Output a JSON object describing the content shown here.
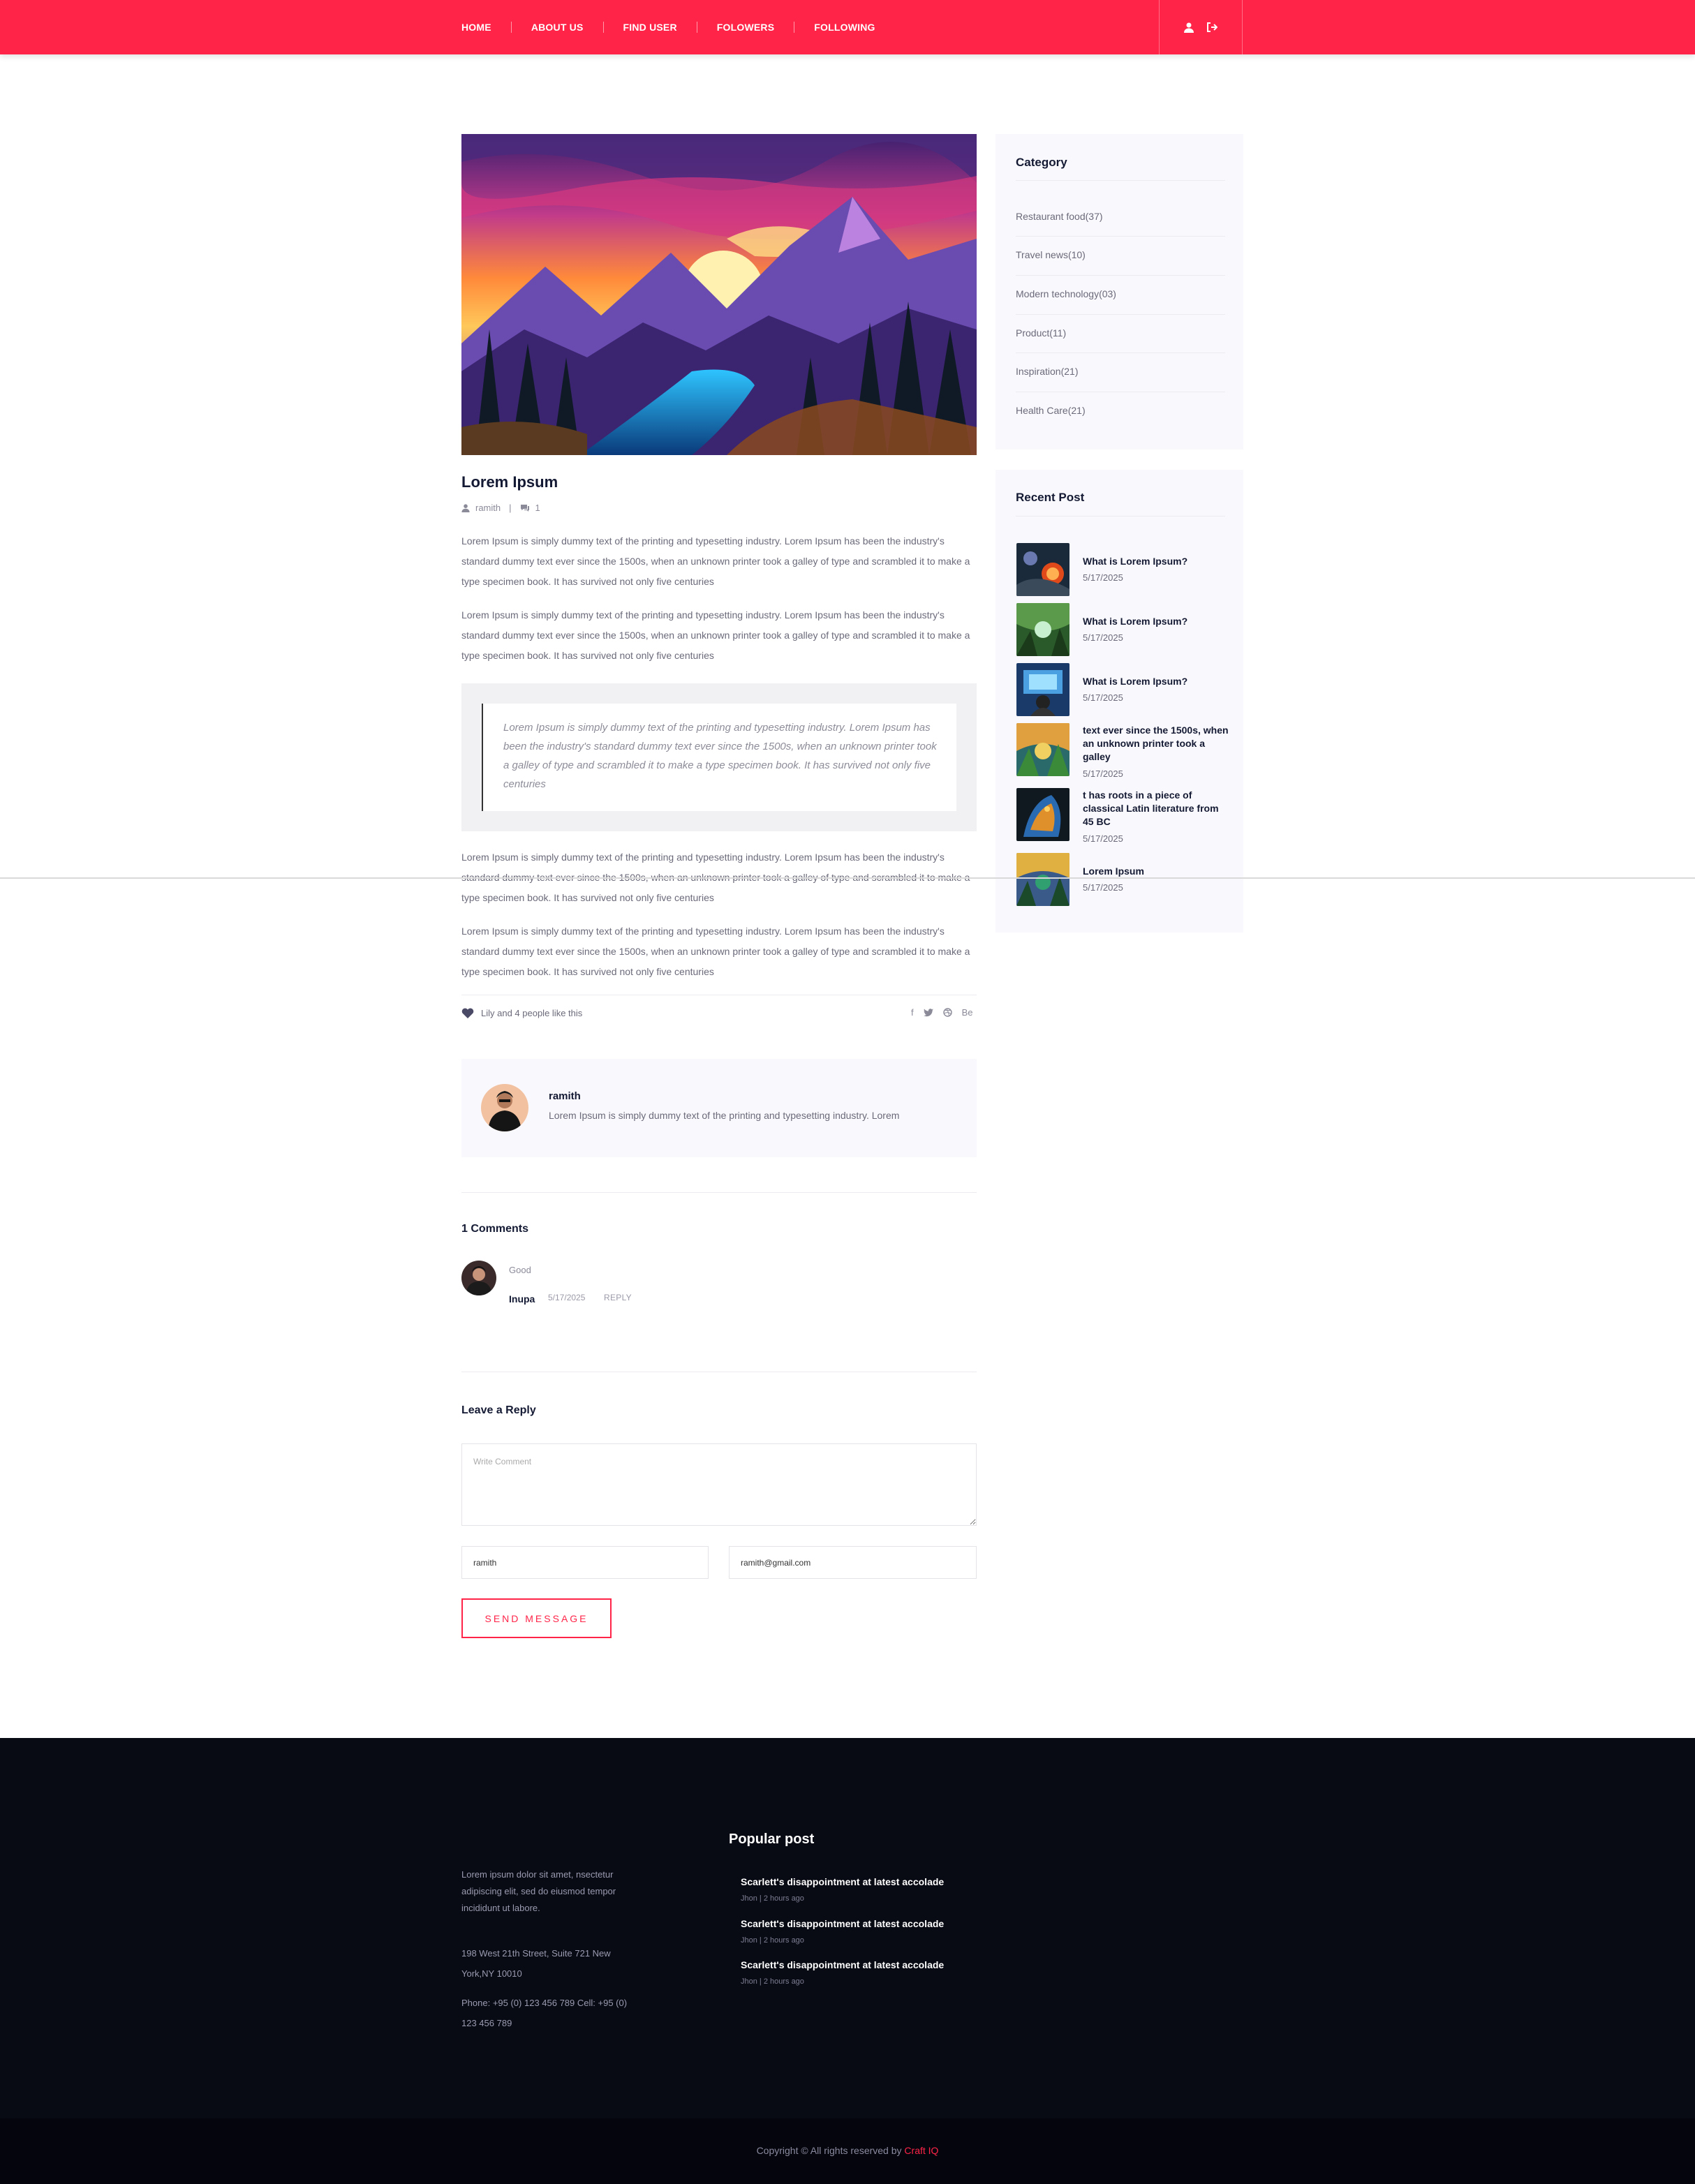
{
  "nav": {
    "items": [
      "HOME",
      "ABOUT US",
      "FIND USER",
      "FOLOWERS",
      "FOLLOWING"
    ],
    "user_icon": "user-icon",
    "logout_icon": "sign-out-icon"
  },
  "post": {
    "title": "Lorem Ipsum",
    "author": "ramith",
    "comment_count": "1",
    "paragraphs": [
      "Lorem Ipsum is simply dummy text of the printing and typesetting industry. Lorem Ipsum has been the industry's standard dummy text ever since the 1500s, when an unknown printer took a galley of type and scrambled it to make a type specimen book. It has survived not only five centuries",
      "Lorem Ipsum is simply dummy text of the printing and typesetting industry. Lorem Ipsum has been the industry's standard dummy text ever since the 1500s, when an unknown printer took a galley of type and scrambled it to make a type specimen book. It has survived not only five centuries",
      "Lorem Ipsum is simply dummy text of the printing and typesetting industry. Lorem Ipsum has been the industry's standard dummy text ever since the 1500s, when an unknown printer took a galley of type and scrambled it to make a type specimen book. It has survived not only five centuries",
      "Lorem Ipsum is simply dummy text of the printing and typesetting industry. Lorem Ipsum has been the industry's standard dummy text ever since the 1500s, when an unknown printer took a galley of type and scrambled it to make a type specimen book. It has survived not only five centuries"
    ],
    "quote": "Lorem Ipsum is simply dummy text of the printing and typesetting industry. Lorem Ipsum has been the industry's standard dummy text ever since the 1500s, when an unknown printer took a galley of type and scrambled it to make a type specimen book. It has survived not only five centuries",
    "likes_text": "Lily and 4 people like this",
    "social": {
      "facebook": "f",
      "behance": "Be"
    }
  },
  "author_box": {
    "name": "ramith",
    "bio": "Lorem Ipsum is simply dummy text of the printing and typesetting industry. Lorem"
  },
  "comments": {
    "title": "1 Comments",
    "items": [
      {
        "text": "Good",
        "name": "Inupa",
        "date": "5/17/2025",
        "reply": "REPLY"
      }
    ]
  },
  "reply_form": {
    "title": "Leave a Reply",
    "comment_placeholder": "Write Comment",
    "name_value": "ramith",
    "email_value": "ramith@gmail.com",
    "submit_label": "SEND MESSAGE"
  },
  "sidebar": {
    "category_title": "Category",
    "categories": [
      "Restaurant food(37)",
      "Travel news(10)",
      "Modern technology(03)",
      "Product(11)",
      "Inspiration(21)",
      "Health Care(21)"
    ],
    "recent_title": "Recent Post",
    "recent_posts": [
      {
        "title": "What is Lorem Ipsum?",
        "date": "5/17/2025"
      },
      {
        "title": "What is Lorem Ipsum?",
        "date": "5/17/2025"
      },
      {
        "title": "What is Lorem Ipsum?",
        "date": "5/17/2025"
      },
      {
        "title": "text ever since the 1500s, when an unknown printer took a galley",
        "date": "5/17/2025"
      },
      {
        "title": "t has roots in a piece of classical Latin literature from 45 BC",
        "date": "5/17/2025"
      },
      {
        "title": "Lorem Ipsum",
        "date": "5/17/2025"
      }
    ]
  },
  "footer": {
    "about": "Lorem ipsum dolor sit amet, nsectetur adipiscing elit, sed do eiusmod tempor incididunt ut labore.",
    "address": "198 West 21th Street, Suite 721 New York,NY 10010",
    "phone": "Phone: +95 (0) 123 456 789 Cell: +95 (0) 123 456 789",
    "popular_title": "Popular post",
    "popular_posts": [
      {
        "title": "Scarlett's disappointment at latest accolade",
        "meta": "Jhon | 2 hours ago"
      },
      {
        "title": "Scarlett's disappointment at latest accolade",
        "meta": "Jhon | 2 hours ago"
      },
      {
        "title": "Scarlett's disappointment at latest accolade",
        "meta": "Jhon | 2 hours ago"
      }
    ],
    "copyright_text": "Copyright © All rights reserved by ",
    "copyright_brand": "Craft IQ"
  },
  "colors": {
    "accent": "#ff2448",
    "footer_bg": "#090b14",
    "sidebar_bg": "#f9f8fc"
  }
}
